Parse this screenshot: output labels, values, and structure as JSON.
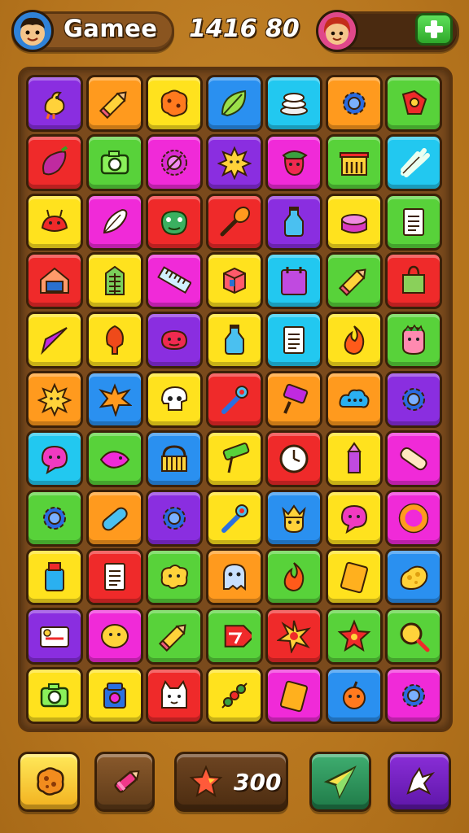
{
  "header": {
    "title": "Gamee",
    "score": "1416 80",
    "player_avatar": "boy-face-icon",
    "opponent_avatar": "girl-face-icon",
    "add_button_icon": "plus-icon"
  },
  "board": {
    "rows": 11,
    "cols": 7,
    "tiles": [
      [
        "purple",
        "bird-icon"
      ],
      [
        "orange",
        "pencil-icon"
      ],
      [
        "yellow",
        "cookie-icon"
      ],
      [
        "blue",
        "leaf-icon"
      ],
      [
        "cyan",
        "plates-icon"
      ],
      [
        "orange",
        "gear-icon"
      ],
      [
        "green",
        "flower-icon"
      ],
      [
        "red",
        "eggplant-icon"
      ],
      [
        "green",
        "camera-icon"
      ],
      [
        "magenta",
        "target-icon"
      ],
      [
        "purple",
        "sun-icon"
      ],
      [
        "magenta",
        "face-hat-icon"
      ],
      [
        "green",
        "building-icon"
      ],
      [
        "cyan",
        "celery-icon"
      ],
      [
        "yellow",
        "crab-icon"
      ],
      [
        "magenta",
        "feather-icon"
      ],
      [
        "red",
        "frog-face-icon"
      ],
      [
        "red",
        "brush-icon"
      ],
      [
        "purple",
        "bottle-icon"
      ],
      [
        "yellow",
        "cake-icon"
      ],
      [
        "green",
        "notepad-icon"
      ],
      [
        "red",
        "house-icon"
      ],
      [
        "yellow",
        "office-building-icon"
      ],
      [
        "magenta",
        "ruler-icon"
      ],
      [
        "yellow",
        "box-icon"
      ],
      [
        "cyan",
        "calendar-icon"
      ],
      [
        "green",
        "pencil-icon"
      ],
      [
        "red",
        "bag-icon"
      ],
      [
        "yellow",
        "kite-icon"
      ],
      [
        "yellow",
        "balloon-icon"
      ],
      [
        "purple",
        "blob-face-icon"
      ],
      [
        "yellow",
        "bottle-icon"
      ],
      [
        "cyan",
        "notepad-icon"
      ],
      [
        "yellow",
        "flame-icon"
      ],
      [
        "green",
        "zombie-face-icon"
      ],
      [
        "orange",
        "sun-icon"
      ],
      [
        "blue",
        "splat-icon"
      ],
      [
        "yellow",
        "skull-icon"
      ],
      [
        "red",
        "wrench-icon"
      ],
      [
        "orange",
        "stamp-icon"
      ],
      [
        "orange",
        "cloud-icon"
      ],
      [
        "purple",
        "gear-icon"
      ],
      [
        "cyan",
        "speech-bubble-icon"
      ],
      [
        "green",
        "fish-icon"
      ],
      [
        "blue",
        "basket-icon"
      ],
      [
        "yellow",
        "roller-icon"
      ],
      [
        "red",
        "clock-icon"
      ],
      [
        "yellow",
        "crayon-icon"
      ],
      [
        "magenta",
        "bandage-icon"
      ],
      [
        "green",
        "gear-icon"
      ],
      [
        "orange",
        "pill-icon"
      ],
      [
        "purple",
        "gear-icon"
      ],
      [
        "yellow",
        "wrench-icon"
      ],
      [
        "blue",
        "crown-face-icon"
      ],
      [
        "yellow",
        "speech-bubble-icon"
      ],
      [
        "magenta",
        "ring-icon"
      ],
      [
        "yellow",
        "glue-icon"
      ],
      [
        "red",
        "notepad-icon"
      ],
      [
        "green",
        "splat-face-icon"
      ],
      [
        "orange",
        "ghost-icon"
      ],
      [
        "green",
        "flame-icon"
      ],
      [
        "yellow",
        "card-icon"
      ],
      [
        "blue",
        "cheese-icon"
      ],
      [
        "purple",
        "id-card-icon"
      ],
      [
        "magenta",
        "lemon-icon"
      ],
      [
        "green",
        "pencil-icon"
      ],
      [
        "green",
        "tag-icon"
      ],
      [
        "red",
        "star-burst-icon"
      ],
      [
        "green",
        "star-icon"
      ],
      [
        "green",
        "magnifier-icon"
      ],
      [
        "yellow",
        "camera-icon"
      ],
      [
        "yellow",
        "robot-icon"
      ],
      [
        "red",
        "cat-face-icon"
      ],
      [
        "yellow",
        "kebab-icon"
      ],
      [
        "magenta",
        "card-icon"
      ],
      [
        "blue",
        "bomb-face-icon"
      ],
      [
        "magenta",
        "gear-icon"
      ]
    ]
  },
  "colors": {
    "purple": "#8a2ee0",
    "orange": "#ff9a1e",
    "yellow": "#ffe21e",
    "blue": "#2a90f0",
    "cyan": "#22c8f0",
    "green": "#58d23a",
    "red": "#ef2a2a",
    "magenta": "#f02ad8"
  },
  "footer": {
    "buttons": [
      {
        "name": "cookie-powerup",
        "icon": "cookie-icon"
      },
      {
        "name": "crayon-powerup",
        "icon": "crayon-icon"
      },
      {
        "name": "star-counter",
        "icon": "star-icon",
        "count": "300"
      },
      {
        "name": "kite-powerup",
        "icon": "kite-icon"
      },
      {
        "name": "bird-powerup",
        "icon": "bird-icon"
      }
    ]
  }
}
